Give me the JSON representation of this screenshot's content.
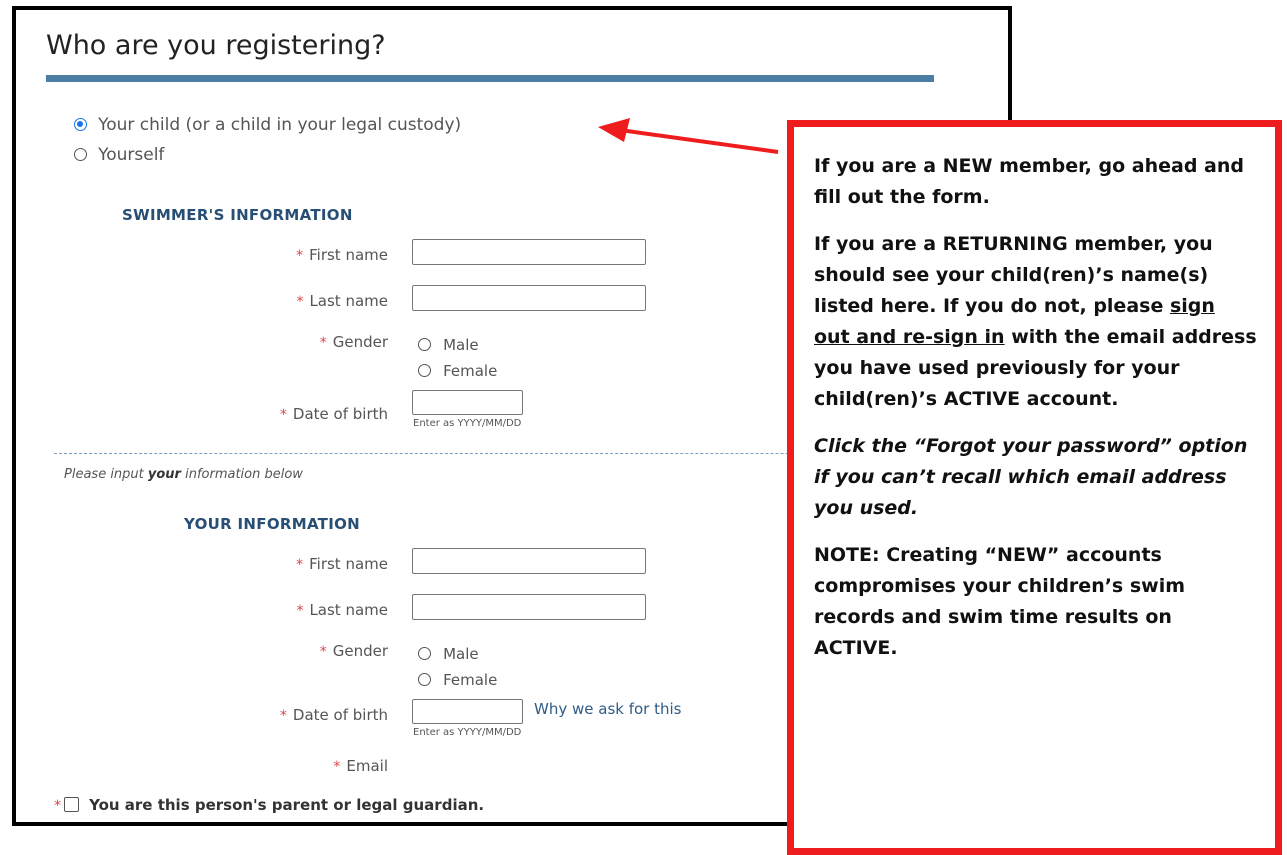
{
  "page": {
    "title": "Who are you registering?"
  },
  "registering": {
    "options": [
      {
        "label": "Your child (or a child in your legal custody)",
        "checked": true
      },
      {
        "label": "Yourself",
        "checked": false
      }
    ]
  },
  "swimmer": {
    "heading": "SWIMMER'S INFORMATION",
    "first_name_label": "First name",
    "last_name_label": "Last name",
    "gender_label": "Gender",
    "gender_options": [
      "Male",
      "Female"
    ],
    "dob_label": "Date of birth",
    "dob_hint": "Enter as YYYY/MM/DD"
  },
  "instruction": {
    "prefix": "Please input ",
    "emphasis": "your",
    "suffix": " information below"
  },
  "your_info": {
    "heading": "YOUR INFORMATION",
    "first_name_label": "First name",
    "last_name_label": "Last name",
    "gender_label": "Gender",
    "gender_options": [
      "Male",
      "Female"
    ],
    "dob_label": "Date of birth",
    "dob_hint": "Enter as YYYY/MM/DD",
    "why_link": "Why we ask for this",
    "email_label": "Email",
    "guardian_label": "You are this person's parent or legal guardian."
  },
  "required_marker": "*",
  "callout": {
    "p1": "If you are a NEW member, go ahead and fill out the form.",
    "p2_before": "If you are a RETURNING member, you should see your child(ren)’s name(s) listed here.  If you do not, please ",
    "p2_link": "sign out and re-sign in",
    "p2_after": " with the email address you have used previously for your child(ren)’s ACTIVE account.",
    "p3": "Click the “Forgot your password” option if you can’t recall which email address you used.",
    "p4": "NOTE: Creating “NEW” accounts compromises your children’s swim records and swim time results on ACTIVE."
  },
  "colors": {
    "accent_rule": "#4a7ea2",
    "required": "#e0434a",
    "callout_border": "#ee1c1c",
    "arrow": "#ee1c1c",
    "heading": "#274e75"
  }
}
